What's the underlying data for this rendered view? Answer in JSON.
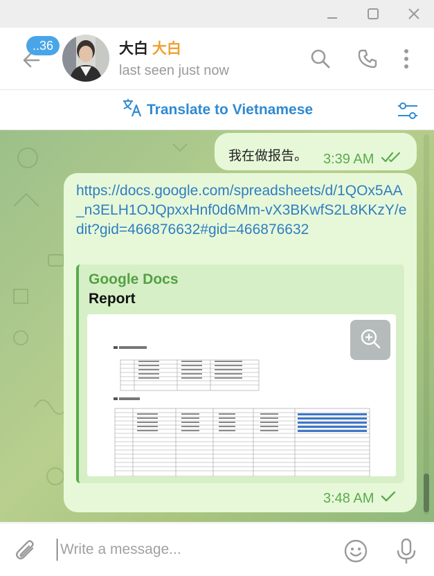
{
  "window": {
    "controls": [
      "minimize-icon",
      "maximize-icon",
      "close-icon"
    ]
  },
  "header": {
    "unread_count": "..36",
    "contact_name": "大白",
    "contact_name_accent": "大白",
    "status": "last seen just now"
  },
  "translate_bar": {
    "label": "Translate to Vietnamese"
  },
  "messages": [
    {
      "text": "我在做报告。",
      "time": "3:39 AM",
      "status": "read"
    },
    {
      "link": "https://docs.google.com/spreadsheets/d/1QOx5AA_n3ELH1OJQpxxHnf0d6Mm-vX3BKwfS2L8KKzY/edit?gid=466876632#gid=466876632",
      "preview": {
        "site": "Google Docs",
        "title": "Report"
      },
      "time": "3:48 AM",
      "status": "sent"
    }
  ],
  "composer": {
    "placeholder": "Write a message..."
  },
  "colors": {
    "accent_blue": "#2f8ad2",
    "bubble_green": "#e7f8d9",
    "meta_green": "#5aab4c",
    "unread_badge": "#4aa5e8",
    "name_accent": "#f0a030"
  }
}
